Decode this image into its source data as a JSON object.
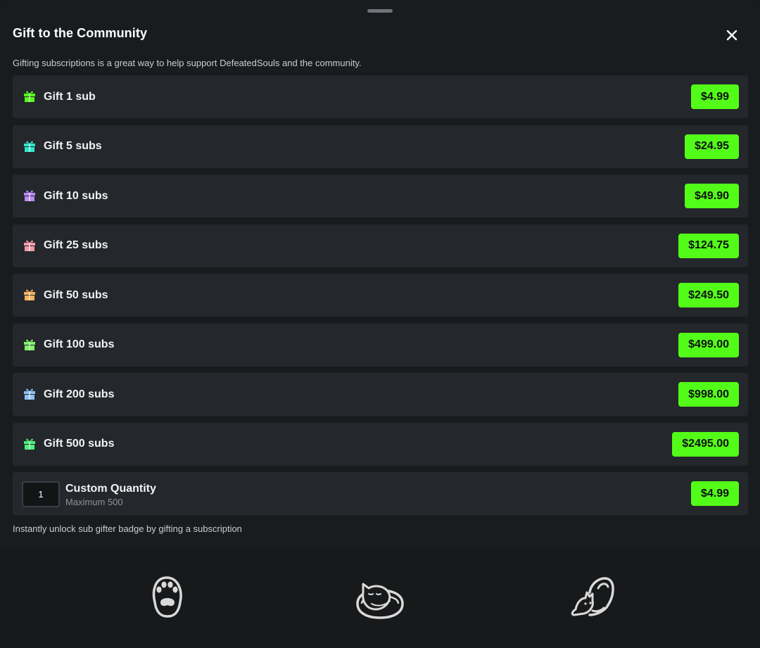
{
  "modal": {
    "title": "Gift to the Community",
    "description": "Gifting subscriptions is a great way to help support DefeatedSouls and the community.",
    "footnote": "Instantly unlock sub gifter badge by gifting a subscription"
  },
  "options": [
    {
      "label": "Gift 1 sub",
      "price": "$4.99",
      "color": "#53fc18",
      "icon": "gift-icon"
    },
    {
      "label": "Gift 5 subs",
      "price": "$24.95",
      "color": "#2ee6c7",
      "icon": "gift-icon"
    },
    {
      "label": "Gift 10 subs",
      "price": "$49.90",
      "color": "#b98af5",
      "icon": "gift-icon"
    },
    {
      "label": "Gift 25 subs",
      "price": "$124.75",
      "color": "#f49aa7",
      "icon": "gift-icon"
    },
    {
      "label": "Gift 50 subs",
      "price": "$249.50",
      "color": "#f6b25e",
      "icon": "gift-icon"
    },
    {
      "label": "Gift 100 subs",
      "price": "$499.00",
      "color": "#7df46a",
      "icon": "gift-icon"
    },
    {
      "label": "Gift 200 subs",
      "price": "$998.00",
      "color": "#8ec1f2",
      "icon": "gift-icon"
    },
    {
      "label": "Gift 500 subs",
      "price": "$2495.00",
      "color": "#4cf07a",
      "icon": "gift-icon"
    }
  ],
  "custom": {
    "quantity": "1",
    "title": "Custom Quantity",
    "subtitle": "Maximum 500",
    "price": "$4.99"
  },
  "bottom_nav": [
    {
      "icon": "paw-icon"
    },
    {
      "icon": "sleeping-cat-icon"
    },
    {
      "icon": "stretching-cat-icon"
    }
  ],
  "colors": {
    "accent": "#53fc18",
    "row_bg": "#24272b",
    "sheet_bg": "#191c1f"
  }
}
